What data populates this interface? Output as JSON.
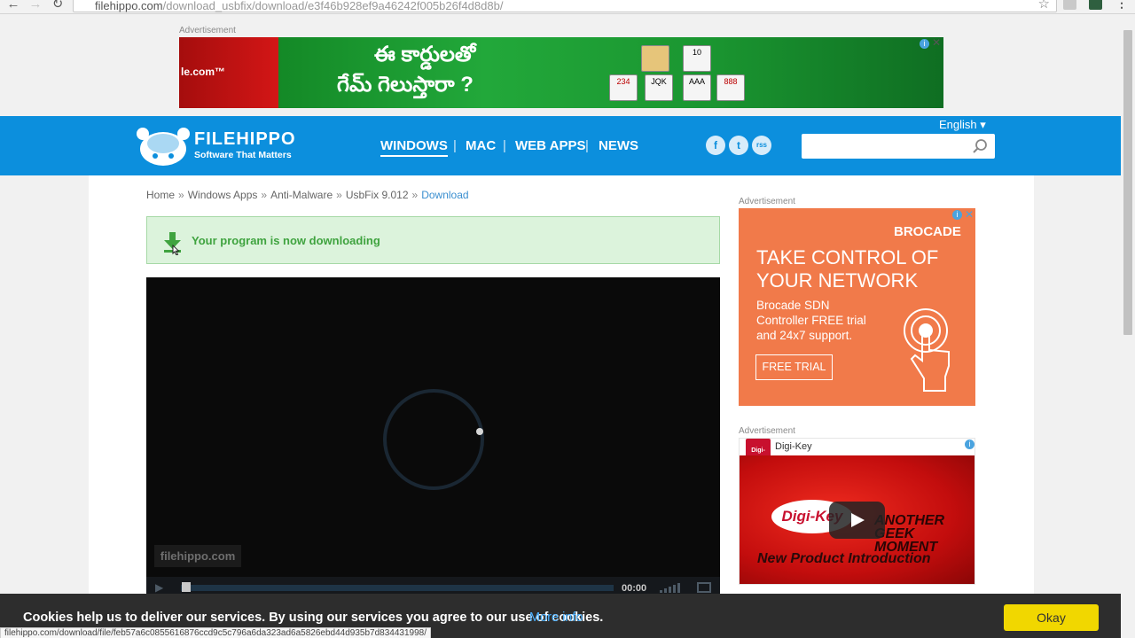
{
  "browser": {
    "url_host": "filehippo.com",
    "url_path": "/download_usbfix/download/e3f46b928ef9a46242f005b26f4d8d8b/",
    "status_url": "filehippo.com/download/file/feb57a6c0855616876ccd9c5c796a6da323ad6a5826ebd44d935b7d834431998/"
  },
  "ads": {
    "label": "Advertisement",
    "top": {
      "brand": "le.com™",
      "line1": "ఈ కార్డులతో",
      "line2": "గేమ్ గెలుస్తారా ?",
      "cards": [
        "234",
        "10",
        "JQK",
        "AAA",
        "888"
      ],
      "info": "i",
      "close": "✕"
    },
    "brocade": {
      "logo": "BROCADE",
      "headline_1": "TAKE CONTROL OF",
      "headline_2": "YOUR NETWORK",
      "body_1": "Brocade SDN",
      "body_2": "Controller FREE trial",
      "body_3": "and 24x7 support.",
      "cta": "FREE TRIAL",
      "info": "i",
      "close": "✕"
    },
    "digikey": {
      "advertiser": "Digi-Key",
      "logo": "Digi-Key",
      "brand": "Digi-Key",
      "tag_1": "ANOTHER",
      "tag_2": "GEEK",
      "tag_3": "MOMENT",
      "intro": "New Product Introduction",
      "info": "i"
    }
  },
  "header": {
    "logo_name": "FILEHIPPO",
    "logo_tagline": "Software That Matters",
    "language": "English ▾",
    "nav": [
      "WINDOWS",
      "MAC",
      "WEB APPS",
      "NEWS"
    ],
    "nav_separator": "|",
    "social": [
      "f",
      "t",
      "rss"
    ],
    "search_value": "",
    "colors": {
      "brand": "#0c8fdd"
    }
  },
  "breadcrumb": {
    "items": [
      "Home",
      "Windows Apps",
      "Anti-Malware",
      "UsbFix 9.012"
    ],
    "current": "Download",
    "separator": "»"
  },
  "download": {
    "message": "Your program is now downloading",
    "colors": {
      "success": "#3fa33f"
    }
  },
  "video": {
    "watermark": "filehippo.com",
    "time": "00:00",
    "progress": 0
  },
  "cookie": {
    "text": "Cookies help us to deliver our services. By using our services you agree to our use of cookies.",
    "link": "More info",
    "button": "Okay"
  }
}
